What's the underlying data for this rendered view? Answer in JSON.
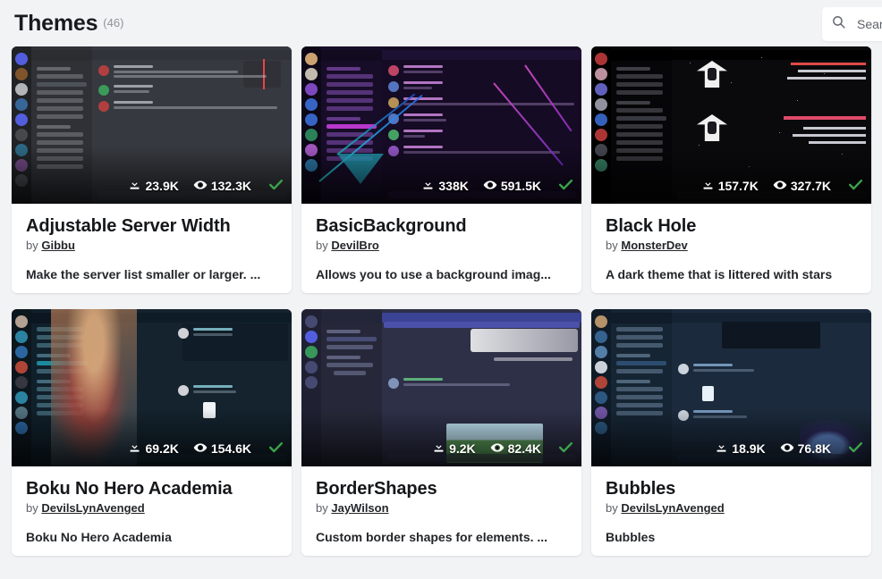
{
  "header": {
    "title": "Themes",
    "count": "(46)"
  },
  "search": {
    "placeholder": "Search",
    "value": "",
    "icon": "search-icon"
  },
  "icons": {
    "download": "download-icon",
    "views": "eye-icon",
    "verified": "check-icon"
  },
  "colors": {
    "page_background": "#f2f3f5",
    "card_background": "#ffffff",
    "title_text": "#1a1a1e",
    "muted_text": "#8f9296",
    "verified_green": "#3ba349"
  },
  "cards": [
    {
      "title": "Adjustable Server Width",
      "by_label": "by",
      "author": "Gibbu",
      "description": "Make the server list smaller or larger. ...",
      "downloads": "23.9K",
      "views": "132.3K",
      "verified": true,
      "theme_class": "t1"
    },
    {
      "title": "BasicBackground",
      "by_label": "by",
      "author": "DevilBro",
      "description": "Allows you to use a background imag...",
      "downloads": "338K",
      "views": "591.5K",
      "verified": true,
      "theme_class": "t2"
    },
    {
      "title": "Black Hole",
      "by_label": "by",
      "author": "MonsterDev",
      "description": "A dark theme that is littered with stars",
      "downloads": "157.7K",
      "views": "327.7K",
      "verified": true,
      "theme_class": "t3"
    },
    {
      "title": "Boku No Hero Academia",
      "by_label": "by",
      "author": "DevilsLynAvenged",
      "description": "Boku No Hero Academia",
      "downloads": "69.2K",
      "views": "154.6K",
      "verified": true,
      "theme_class": "t4"
    },
    {
      "title": "BorderShapes",
      "by_label": "by",
      "author": "JayWilson",
      "description": "Custom border shapes for elements. ...",
      "downloads": "9.2K",
      "views": "82.4K",
      "verified": true,
      "theme_class": "t5"
    },
    {
      "title": "Bubbles",
      "by_label": "by",
      "author": "DevilsLynAvenged",
      "description": "Bubbles",
      "downloads": "18.9K",
      "views": "76.8K",
      "verified": true,
      "theme_class": "t6"
    }
  ]
}
